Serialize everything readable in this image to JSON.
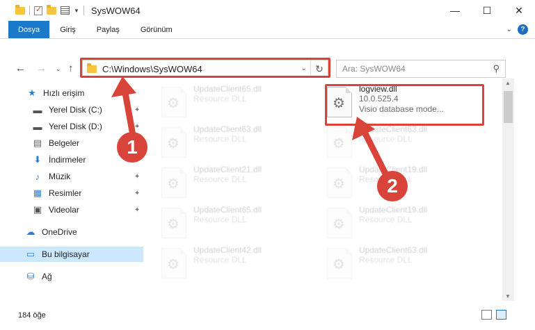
{
  "window": {
    "title": "SysWOW64",
    "minimize": "—",
    "maximize": "☐",
    "close": "✕"
  },
  "ribbon": {
    "tabs": [
      "Dosya",
      "Giriş",
      "Paylaş",
      "Görünüm"
    ],
    "collapse_icon": "chevron-down-icon",
    "help_icon": "help-icon",
    "help_label": "?"
  },
  "address": {
    "path": "C:\\Windows\\SysWOW64",
    "search_placeholder": "Ara: SysWOW64"
  },
  "sidebar": {
    "items": [
      {
        "label": "Hızlı erişim",
        "icon": "star-icon",
        "glyph": "★",
        "color": "#2a7fd4",
        "pinned": false
      },
      {
        "label": "Yerel Disk (C:)",
        "icon": "drive-icon",
        "glyph": "▬",
        "color": "#555",
        "pinned": true
      },
      {
        "label": "Yerel Disk (D:)",
        "icon": "drive-icon",
        "glyph": "▬",
        "color": "#555",
        "pinned": true
      },
      {
        "label": "Belgeler",
        "icon": "document-icon",
        "glyph": "▤",
        "color": "#666",
        "pinned": true
      },
      {
        "label": "İndirmeler",
        "icon": "download-icon",
        "glyph": "⬇",
        "color": "#2a7fd4",
        "pinned": true
      },
      {
        "label": "Müzik",
        "icon": "music-icon",
        "glyph": "♪",
        "color": "#2a7fd4",
        "pinned": true
      },
      {
        "label": "Resimler",
        "icon": "pictures-icon",
        "glyph": "▦",
        "color": "#2a7fd4",
        "pinned": true
      },
      {
        "label": "Videolar",
        "icon": "video-icon",
        "glyph": "▣",
        "color": "#555",
        "pinned": true
      },
      {
        "label": "OneDrive",
        "icon": "cloud-icon",
        "glyph": "☁",
        "color": "#2a7fd4",
        "pinned": false
      },
      {
        "label": "Bu bilgisayar",
        "icon": "computer-icon",
        "glyph": "▭",
        "color": "#2a7fd4",
        "pinned": false,
        "selected": true
      },
      {
        "label": "Ağ",
        "icon": "network-icon",
        "glyph": "⛁",
        "color": "#2a7fd4",
        "pinned": false
      }
    ],
    "pin_glyph": "📌"
  },
  "files": [
    {
      "name": "UpdateClient65.dll",
      "desc1": "Resource DLL",
      "desc2": "",
      "highlight": false
    },
    {
      "name": "logview.dll",
      "desc1": "10.0.525.4",
      "desc2": "Visio database mode...",
      "highlight": true
    },
    {
      "name": "UpdateClient63.dll",
      "desc1": "Resource DLL",
      "desc2": "",
      "highlight": false
    },
    {
      "name": "UpdateClient63.dll",
      "desc1": "Resource DLL",
      "desc2": "",
      "highlight": false
    },
    {
      "name": "UpdateClient21.dll",
      "desc1": "Resource DLL",
      "desc2": "",
      "highlight": false
    },
    {
      "name": "UpdateClient19.dll",
      "desc1": "Resource DLL",
      "desc2": "",
      "highlight": false
    },
    {
      "name": "UpdateClient65.dll",
      "desc1": "Resource DLL",
      "desc2": "",
      "highlight": false
    },
    {
      "name": "UpdateClient19.dll",
      "desc1": "Resource DLL",
      "desc2": "",
      "highlight": false
    },
    {
      "name": "UpdateClient42.dll",
      "desc1": "Resource DLL",
      "desc2": "",
      "highlight": false
    },
    {
      "name": "UpdateClient63.dll",
      "desc1": "Resource DLL",
      "desc2": "",
      "highlight": false
    }
  ],
  "status": {
    "item_count": "184 öğe"
  },
  "annotations": {
    "badge1": "1",
    "badge2": "2",
    "color": "#d9443a"
  }
}
